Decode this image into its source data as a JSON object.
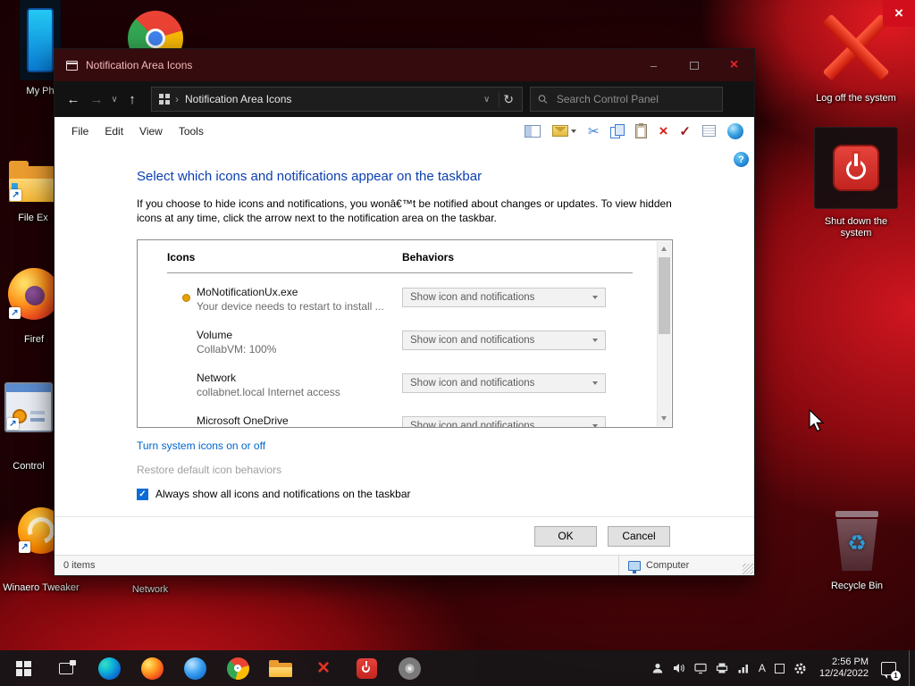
{
  "colors": {
    "titlebar": "#360b0e",
    "close_red": "#e8232d",
    "heading_blue": "#0b3fae",
    "link_blue": "#0066cc",
    "checkbox_blue": "#0b6cd8"
  },
  "glyphs": {
    "back": "←",
    "forward": "→",
    "up": "↑",
    "refresh": "↻",
    "chevron_down": "∨",
    "crumb_sep": "›",
    "minimize": "–",
    "close": "×",
    "scissors": "✂",
    "delete": "×",
    "check": "✓",
    "help": "?",
    "checkmark": "✓",
    "recycle": "♻",
    "shortcut_arrow": "↗"
  },
  "desktop": {
    "icons_left": [
      {
        "id": "my-phone",
        "label": "My Ph"
      },
      {
        "id": "file-explorer",
        "label": "File Ex"
      },
      {
        "id": "firefox",
        "label": "Firef"
      },
      {
        "id": "control-panel",
        "label": "Control"
      },
      {
        "id": "winaero-tweaker",
        "label": "Winaero Tweaker"
      },
      {
        "id": "network",
        "label": "Network"
      }
    ],
    "icons_right": [
      {
        "id": "log-off",
        "label": "Log off the system"
      },
      {
        "id": "shut-down",
        "label": "Shut down the system"
      },
      {
        "id": "recycle-bin",
        "label": "Recycle Bin"
      }
    ]
  },
  "window": {
    "title": "Notification Area Icons",
    "address": {
      "breadcrumb": "Notification Area Icons",
      "search_placeholder": "Search Control Panel"
    },
    "menus": [
      "File",
      "Edit",
      "View",
      "Tools"
    ],
    "page": {
      "heading": "Select which icons and notifications appear on the taskbar",
      "intro": "If you choose to hide icons and notifications, you wonâ€™t be notified about changes or updates. To view hidden icons at any time, click the arrow next to the notification area on the taskbar.",
      "col_icons": "Icons",
      "col_behaviors": "Behaviors",
      "rows": [
        {
          "name": "MoNotificationUx.exe",
          "desc": "Your device needs to restart to install ...",
          "behavior": "Show icon and notifications"
        },
        {
          "name": "Volume",
          "desc": "CollabVM: 100%",
          "behavior": "Show icon and notifications"
        },
        {
          "name": "Network",
          "desc": "collabnet.local Internet access",
          "behavior": "Show icon and notifications"
        },
        {
          "name": "Microsoft OneDrive",
          "desc": "",
          "behavior": "Show icon and notifications"
        }
      ],
      "link_system_icons": "Turn system icons on or off",
      "link_restore": "Restore default icon behaviors",
      "checkbox_label": "Always show all icons and notifications on the taskbar",
      "checkbox_checked": true,
      "ok": "OK",
      "cancel": "Cancel"
    },
    "status": {
      "left": "0 items",
      "zone": "Computer"
    }
  },
  "taskbar": {
    "language_indicator": "A",
    "clock_time": "2:56 PM",
    "clock_date": "12/24/2022",
    "notification_count": "1"
  }
}
